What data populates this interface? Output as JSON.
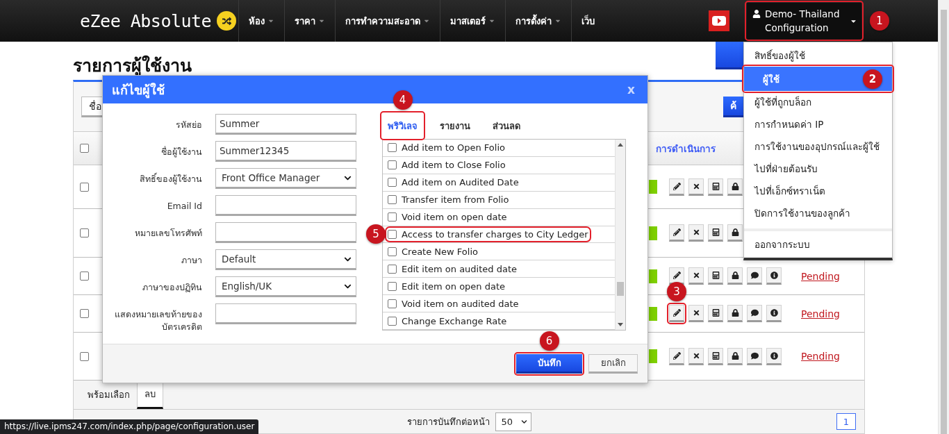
{
  "navbar": {
    "brand": "eZee Absolute",
    "menu": [
      {
        "label": "ห้อง",
        "has_caret": true
      },
      {
        "label": "ราคา",
        "has_caret": true
      },
      {
        "label": "การทำความสะอาด",
        "has_caret": true
      },
      {
        "label": "มาสเตอร์",
        "has_caret": true
      },
      {
        "label": "การตั้งค่า",
        "has_caret": true
      },
      {
        "label": "เว็บ",
        "has_caret": false
      }
    ],
    "user_menu": {
      "label": "Demo- Thailand Configuration",
      "expanded": true,
      "callout": {
        "label": "1"
      }
    }
  },
  "user_dropdown": {
    "items": [
      {
        "label": "สิทธิ์ของผู้ใช้",
        "selected": false
      },
      {
        "label": "ผู้ใช้",
        "selected": true,
        "callout": {
          "label": "2"
        }
      },
      {
        "label": "ผู้ใช้ที่ถูกบล็อก",
        "selected": false
      },
      {
        "label": "การกำหนดค่า IP",
        "selected": false
      },
      {
        "label": "การใช้งานของอุปกรณ์และผู้ใช้",
        "selected": false
      },
      {
        "label": "ไปที่ฝ่ายต้อนรับ",
        "selected": false
      },
      {
        "label": "ไปที่เอ็กซ์ทราเน็ต",
        "selected": false
      },
      {
        "label": "ปิดการใช้งานของลูกค้า",
        "selected": false
      }
    ],
    "logout": "ออกจากระบบ"
  },
  "page": {
    "title": "รายการผู้ใช้งาน",
    "toolbar_left": "ชื่อ",
    "toolbar_right": "ค้",
    "table": {
      "header_checked": false,
      "header_action": "การดำเนินการ",
      "rows": [
        {
          "checked": false
        },
        {
          "checked": false
        },
        {
          "checked": false,
          "status": "Pending"
        },
        {
          "checked": false,
          "status": "Pending",
          "edit_callout": {
            "label": "3"
          }
        },
        {
          "checked": false,
          "status": "Pending"
        }
      ]
    },
    "bulk_tabs": [
      {
        "label": "พร้อมเลือก",
        "selected": false
      },
      {
        "label": "ลบ",
        "selected": true
      }
    ],
    "footer": {
      "per_page_label": "รายการบันทึกต่อหน้า",
      "per_page": "50",
      "pages": [
        {
          "label": "1",
          "selected": true
        }
      ]
    }
  },
  "dialog": {
    "title": "แก้ไขผู้ใช้",
    "close": "x",
    "fields": [
      {
        "label": "รหัสย่อ",
        "kind": "text",
        "value": "Summer"
      },
      {
        "label": "ชื่อผู้ใช้งาน",
        "kind": "text",
        "value": "Summer12345"
      },
      {
        "label": "สิทธิ์ของผู้ใช้งาน",
        "kind": "select",
        "value": "Front Office Manager"
      },
      {
        "label": "Email Id",
        "kind": "text"
      },
      {
        "label": "หมายเลขโทรศัพท์",
        "kind": "text"
      },
      {
        "label": "ภาษา",
        "kind": "select",
        "value": "Default"
      },
      {
        "label": "ภาษาของปฏิทิน",
        "kind": "select",
        "value": "English/UK"
      },
      {
        "label": "แสดงหมายเลขท้ายของบัตรเครดิต",
        "kind": "text"
      }
    ],
    "tabs": [
      {
        "label": "พริวิเลจ",
        "selected": true,
        "callout": {
          "label": "4"
        }
      },
      {
        "label": "รายงาน",
        "selected": false
      },
      {
        "label": "ส่วนลด",
        "selected": false
      }
    ],
    "privileges": [
      {
        "label": "Add item to Open Folio",
        "checked": false
      },
      {
        "label": "Add item to Close Folio",
        "checked": false
      },
      {
        "label": "Add item on Audited Date",
        "checked": false
      },
      {
        "label": "Transfer item from Folio",
        "checked": false
      },
      {
        "label": "Void item on open date",
        "checked": false
      },
      {
        "label": "Access to transfer charges to City Ledger",
        "checked": false,
        "callout": {
          "label": "5"
        }
      },
      {
        "label": "Create New Folio",
        "checked": false
      },
      {
        "label": "Edit item on audited date",
        "checked": false
      },
      {
        "label": "Edit item on open date",
        "checked": false
      },
      {
        "label": "Void item on audited date",
        "checked": false
      },
      {
        "label": "Change Exchange Rate",
        "checked": false
      }
    ],
    "save": {
      "label": "บันทึก",
      "callout": {
        "label": "6"
      }
    },
    "cancel": "ยกเลิก"
  },
  "status_url": "https://live.ipms247.com/index.php/page/configuration.user"
}
